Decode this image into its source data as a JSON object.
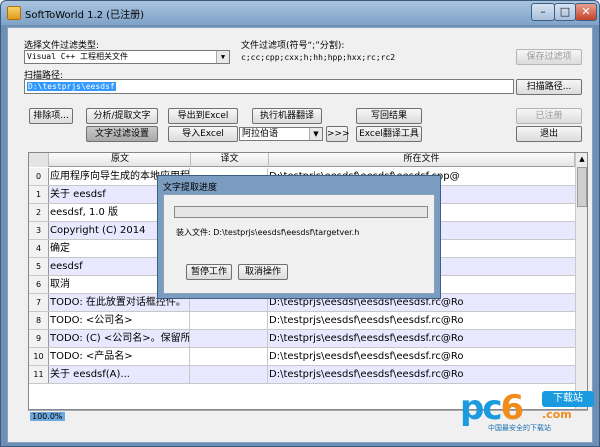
{
  "window": {
    "title": "SoftToWorld 1.2 (已注册)"
  },
  "filter": {
    "type_label": "选择文件过滤类型:",
    "type_value": "Visual C++ 工程相关文件",
    "ext_label": "文件过滤项(符号“;”分割):",
    "ext_value": "c;cc;cpp;cxx;h;hh;hpp;hxx;rc;rc2",
    "save_button": "保存过滤项"
  },
  "scan": {
    "path_label": "扫描路径:",
    "path_value": "D:\\testprjs\\eesdsf",
    "scan_button": "扫描路径..."
  },
  "toolbar": {
    "exclude": "排除项...",
    "analyze": "分析/提取文字",
    "export_excel": "导出到Excel",
    "machine_translate": "执行机器翻译",
    "write_result": "写回结果",
    "registered": "已注册",
    "text_filter_settings": "文字过滤设置",
    "import_excel": "导入Excel",
    "language": "阿拉伯语",
    "arrow": ">>>",
    "excel_translate_tool": "Excel翻译工具",
    "exit": "退出"
  },
  "grid": {
    "headers": [
      "原文",
      "译文",
      "所在文件"
    ],
    "rows": [
      {
        "n": "0",
        "orig": "应用程序向导生成的本地应用程序",
        "file": "D:\\testprjs\\eesdsf\\eesdsf\\eesdsf.cpp@",
        "green": false
      },
      {
        "n": "1",
        "orig": "关于 eesdsf",
        "file": "rc@Ro",
        "green": false
      },
      {
        "n": "2",
        "orig": "eesdsf, 1.0 版",
        "file": "rc@Ro",
        "green": false
      },
      {
        "n": "3",
        "orig": "Copyright (C) 2014",
        "file": "rc@Ro",
        "green": false
      },
      {
        "n": "4",
        "orig": "确定",
        "file": "dsf.r",
        "green": false
      },
      {
        "n": "5",
        "orig": "eesdsf",
        "file": "dsf.r",
        "green": true
      },
      {
        "n": "6",
        "orig": "取消",
        "file": "rc@Ro",
        "green": false
      },
      {
        "n": "7",
        "orig": "TODO: 在此放置对话框控件。",
        "file": "D:\\testprjs\\eesdsf\\eesdsf\\eesdsf.rc@Ro",
        "green": false
      },
      {
        "n": "8",
        "orig": "TODO: <公司名>",
        "file": "D:\\testprjs\\eesdsf\\eesdsf\\eesdsf.rc@Ro",
        "green": false
      },
      {
        "n": "9",
        "orig": "TODO: (C) <公司名>。保留所有权利。",
        "file": "D:\\testprjs\\eesdsf\\eesdsf\\eesdsf.rc@Ro",
        "green": false
      },
      {
        "n": "10",
        "orig": "TODO: <产品名>",
        "file": "D:\\testprjs\\eesdsf\\eesdsf\\eesdsf.rc@Ro",
        "green": false
      },
      {
        "n": "11",
        "orig": "关于 eesdsf(A)...",
        "file": "D:\\testprjs\\eesdsf\\eesdsf\\eesdsf.rc@Ro",
        "green": false
      }
    ]
  },
  "status": {
    "zoom": "100.0%"
  },
  "dialog": {
    "title": "文字提取进度",
    "progress": 0,
    "import_file": "装入文件: D:\\testprjs\\eesdsf\\eesdsf\\targetver.h",
    "pause": "暂停工作",
    "cancel": "取消操作"
  },
  "watermark": {
    "brand": "pc6",
    "badge": "下载站",
    "domain": ".com",
    "slogan": "中国最安全的下载站"
  }
}
